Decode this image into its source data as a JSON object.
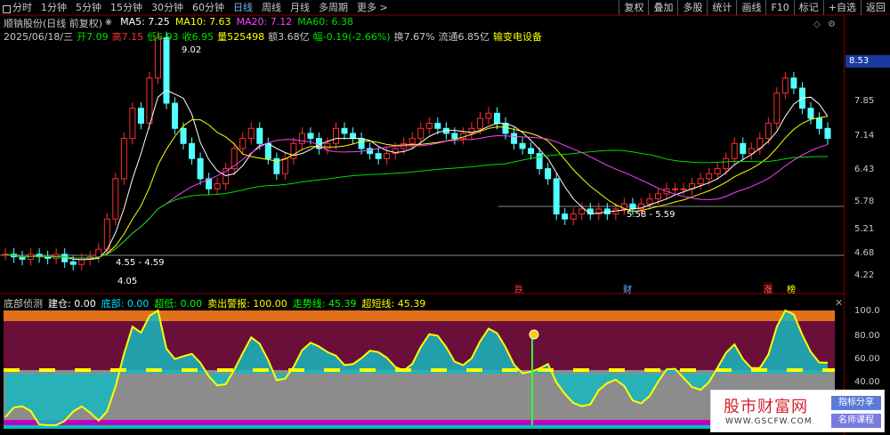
{
  "tabs": [
    {
      "label": "分时",
      "active": false
    },
    {
      "label": "1分钟",
      "active": false
    },
    {
      "label": "5分钟",
      "active": false
    },
    {
      "label": "15分钟",
      "active": false
    },
    {
      "label": "30分钟",
      "active": false
    },
    {
      "label": "60分钟",
      "active": false
    },
    {
      "label": "日线",
      "active": true
    },
    {
      "label": "周线",
      "active": false
    },
    {
      "label": "月线",
      "active": false
    },
    {
      "label": "多周期",
      "active": false
    },
    {
      "label": "更多 >",
      "active": false
    }
  ],
  "toolbar": [
    "复权",
    "叠加",
    "多股",
    "统计",
    "画线",
    "F10",
    "标记",
    "+自选",
    "返回"
  ],
  "stock": {
    "title": "顺钠股份(日线 前复权)",
    "ma5_label": "MA5: 7.25",
    "ma10_label": "MA10: 7.63",
    "ma20_label": "MA20: 7.12",
    "ma60_label": "MA60: 6.38",
    "date": "2025/06/18/三",
    "open_label": "开",
    "open": "7.09",
    "high_label": "高",
    "high": "7.15",
    "low_label": "低",
    "low": "6.93",
    "close_label": "收",
    "close": "6.95",
    "volume_label": "量",
    "volume": "525498",
    "amount_label": "额",
    "amount": "3.68亿",
    "change_label": "幅",
    "change": "-0.19(-2.66%)",
    "turnover_label": "换",
    "turnover": "7.67%",
    "float_label": "流通",
    "float": "6.85亿",
    "sector": "输变电设备"
  },
  "price_axis": [
    "8.53",
    "7.85",
    "7.14",
    "6.43",
    "5.78",
    "5.21",
    "4.68",
    "4.22"
  ],
  "annotations": {
    "high_mark": "9.02",
    "low_range_1": "4.55 - 4.59",
    "low_mark": "4.05",
    "range_2": "5.58 - 5.59",
    "signal_die": "跌",
    "signal_cai": "财",
    "signal_zhang": "涨",
    "signal_bang": "榜"
  },
  "indicator": {
    "name": "底部侦测",
    "items": [
      {
        "label": "建仓:",
        "value": "0.00",
        "color": "#ffffff"
      },
      {
        "label": "底部:",
        "value": "0.00",
        "color": "#00e0ff"
      },
      {
        "label": "超低:",
        "value": "0.00",
        "color": "#00ff00"
      },
      {
        "label": "卖出警报:",
        "value": "100.00",
        "color": "#ffff00"
      },
      {
        "label": "走势线:",
        "value": "45.39",
        "color": "#00ff00"
      },
      {
        "label": "超短线:",
        "value": "45.39",
        "color": "#ffff00"
      }
    ],
    "axis": [
      "100.0",
      "80.00",
      "60.00",
      "40.00"
    ]
  },
  "watermark": {
    "main": "股市财富网",
    "url": "WWW.GSCFW.COM",
    "badge1": "指标分享",
    "badge2": "名师课程"
  },
  "colors": {
    "up": "#ff3030",
    "down": "#54ffff",
    "ma5": "#ffffff",
    "ma10": "#ffff00",
    "ma20": "#ff40ff",
    "ma60": "#00dd00"
  }
}
